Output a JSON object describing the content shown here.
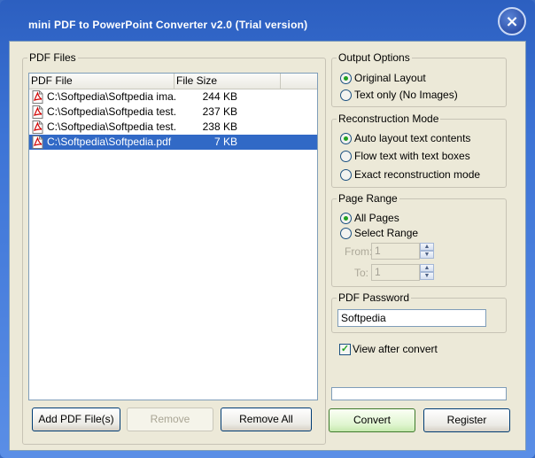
{
  "window": {
    "title": "mini PDF to PowerPoint Converter v2.0 (Trial version)",
    "close_glyph": "×"
  },
  "files": {
    "group_label": "PDF Files",
    "columns": [
      "PDF File",
      "File Size"
    ],
    "rows": [
      {
        "name": "C:\\Softpedia\\Softpedia ima...",
        "size": "244 KB",
        "selected": false
      },
      {
        "name": "C:\\Softpedia\\Softpedia test....",
        "size": "237 KB",
        "selected": false
      },
      {
        "name": "C:\\Softpedia\\Softpedia test....",
        "size": "238 KB",
        "selected": false
      },
      {
        "name": "C:\\Softpedia\\Softpedia.pdf",
        "size": "7 KB",
        "selected": true
      }
    ],
    "row_icon": "pdf-file-icon"
  },
  "buttons": {
    "add": "Add PDF File(s)",
    "remove": "Remove",
    "remove_all": "Remove All",
    "convert": "Convert",
    "register": "Register"
  },
  "output_options": {
    "label": "Output Options",
    "options": [
      "Original Layout",
      "Text only (No Images)"
    ],
    "selected": 0
  },
  "reconstruction": {
    "label": "Reconstruction Mode",
    "options": [
      "Auto layout text contents",
      "Flow text with text boxes",
      "Exact reconstruction mode"
    ],
    "selected": 0
  },
  "page_range": {
    "label": "Page Range",
    "options": [
      "All Pages",
      "Select Range"
    ],
    "selected": 0,
    "from_label": "From:",
    "to_label": "To:",
    "from_value": "1",
    "to_value": "1"
  },
  "password": {
    "label": "PDF Password",
    "value": "Softpedia"
  },
  "view_after": {
    "label": "View after convert",
    "checked": true,
    "check_glyph": "✓"
  },
  "progress": {
    "value": 0
  },
  "colors": {
    "titlebar": "#2c5fc0",
    "client": "#ece9d8",
    "selection": "#3169c6",
    "radio_dot": "#21a121"
  }
}
